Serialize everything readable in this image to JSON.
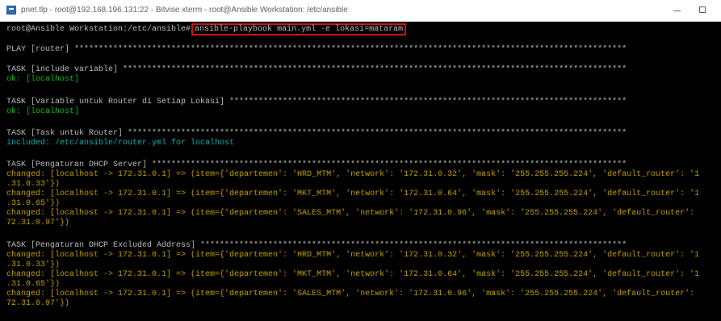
{
  "window": {
    "title": "pnet.tlp - root@192.168.196.131:22 - Bitvise xterm - root@Ansible Workstation: /etc/ansible"
  },
  "terminal": {
    "prompt": "root@Ansible Workstation:/etc/ansible#",
    "command": "ansible-playbook main.yml -e lokasi=mataram",
    "lines": [
      "PLAY [router] ******************************************************************************************************************",
      "TASK [include variable] ********************************************************************************************************",
      "ok: [localhost]",
      "TASK [Variable untuk Router di Setiap Lokasi] **********************************************************************************",
      "ok: [localhost]",
      "TASK [Task untuk Router] *******************************************************************************************************",
      "included: /etc/ansible/router.yml for localhost",
      "TASK [Pengaturan DHCP Server] **************************************************************************************************",
      "changed: [localhost -> 172.31.0.1] => (item={'departemen': 'HRD_MTM', 'network': '172.31.0.32', 'mask': '255.255.255.224', 'default_router': '1",
      ".31.0.33'})",
      "changed: [localhost -> 172.31.0.1] => (item={'departemen': 'MKT_MTM', 'network': '172.31.0.64', 'mask': '255.255.255.224', 'default_router': '1",
      ".31.0.65'})",
      "changed: [localhost -> 172.31.0.1] => (item={'departemen': 'SALES_MTM', 'network': '172.31.0.96', 'mask': '255.255.255.224', 'default_router':",
      "72.31.0.97'})",
      "TASK [Pengaturan DHCP Excluded Address] ****************************************************************************************",
      "changed: [localhost -> 172.31.0.1] => (item={'departemen': 'HRD_MTM', 'network': '172.31.0.32', 'mask': '255.255.255.224', 'default_router': '1",
      ".31.0.33'})",
      "changed: [localhost -> 172.31.0.1] => (item={'departemen': 'MKT_MTM', 'network': '172.31.0.64', 'mask': '255.255.255.224', 'default_router': '1",
      ".31.0.65'})",
      "changed: [localhost -> 172.31.0.1] => (item={'departemen': 'SALES_MTM', 'network': '172.31.0.96', 'mask': '255.255.255.224', 'default_router':",
      "72.31.0.97'})"
    ]
  },
  "colors": {
    "background": "#000000",
    "default_text": "#c0c0c0",
    "ok": "#12c712",
    "changed": "#c8a400",
    "included": "#10b8b8",
    "highlight_box": "#e01010"
  },
  "icons": {
    "app": "terminal-app-icon",
    "minimize": "minimize-icon",
    "maximize": "maximize-icon"
  }
}
